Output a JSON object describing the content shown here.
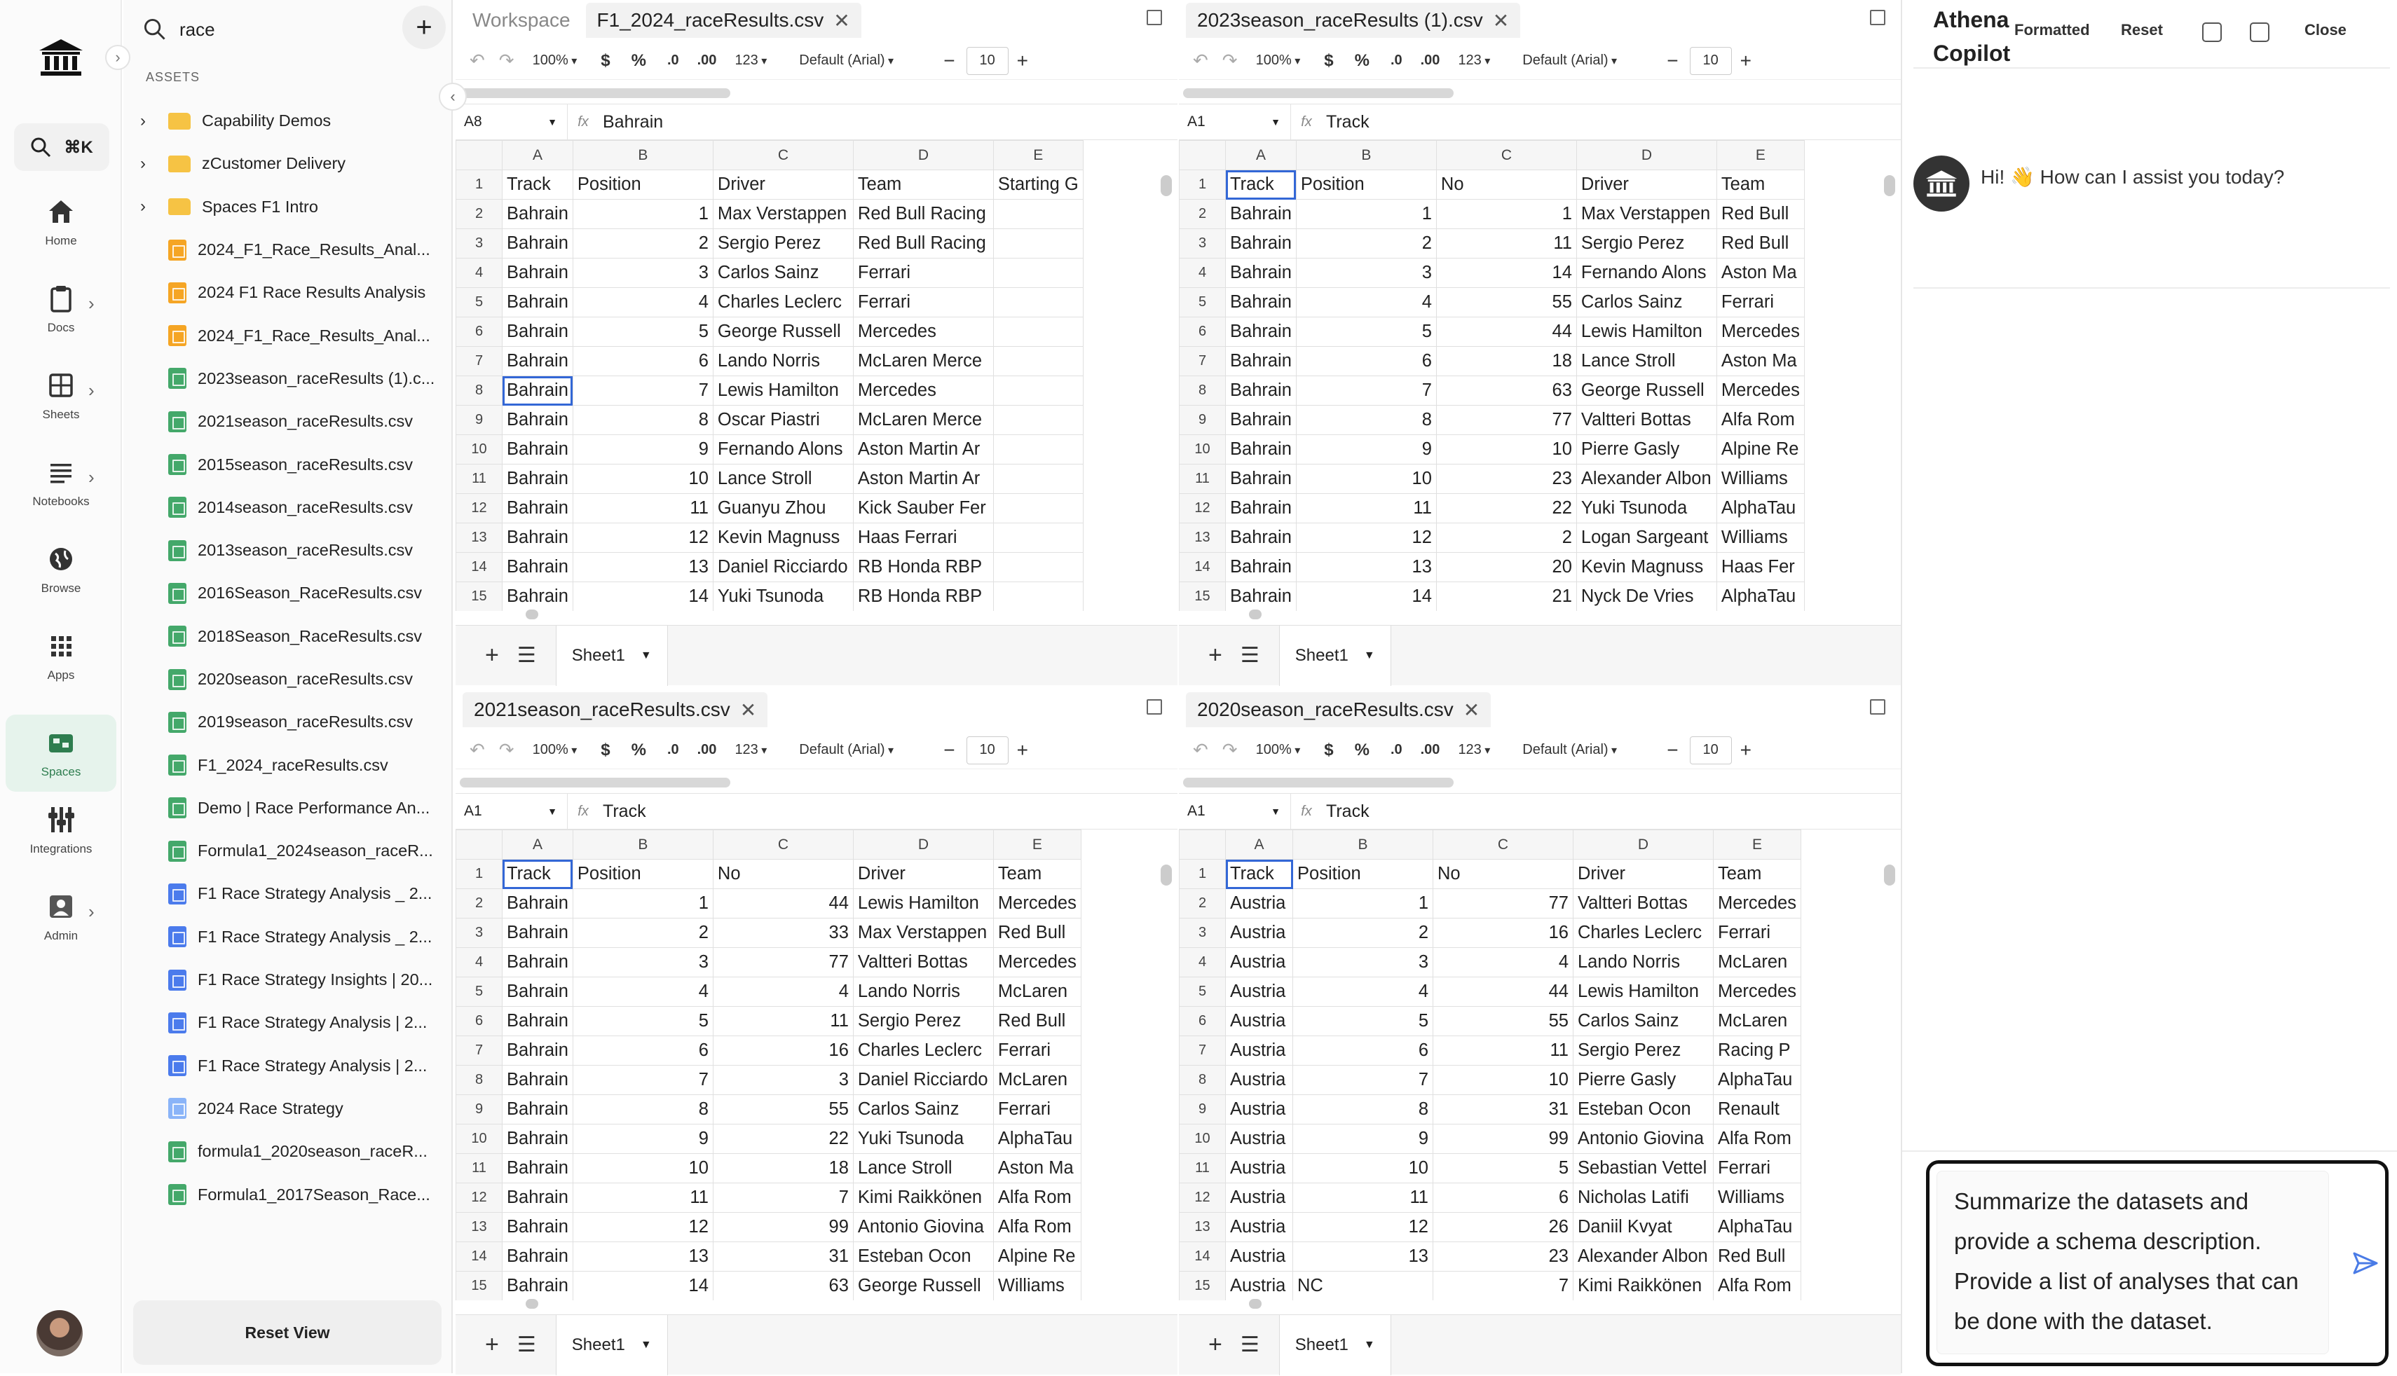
{
  "rail": {
    "search_shortcut": "⌘K",
    "items": [
      {
        "label": "Home",
        "icon": "home-icon"
      },
      {
        "label": "Docs",
        "icon": "docs-icon"
      },
      {
        "label": "Sheets",
        "icon": "sheets-icon"
      },
      {
        "label": "Notebooks",
        "icon": "notebooks-icon"
      },
      {
        "label": "Browse",
        "icon": "globe-icon"
      },
      {
        "label": "Apps",
        "icon": "apps-grid-icon"
      },
      {
        "label": "Spaces",
        "icon": "spaces-icon"
      },
      {
        "label": "Integrations",
        "icon": "integrations-icon"
      },
      {
        "label": "Admin",
        "icon": "admin-icon"
      }
    ],
    "active_item": "Spaces",
    "accent_color": "#2e7d4f"
  },
  "assets": {
    "search_value": "race",
    "section_label": "ASSETS",
    "reset_label": "Reset View",
    "items": [
      {
        "label": "Capability Demos",
        "type": "folder"
      },
      {
        "label": "zCustomer Delivery",
        "type": "folder"
      },
      {
        "label": "Spaces F1 Intro",
        "type": "folder"
      },
      {
        "label": "2024_F1_Race_Results_Anal...",
        "type": "doc"
      },
      {
        "label": "2024 F1 Race Results Analysis",
        "type": "doc"
      },
      {
        "label": "2024_F1_Race_Results_Anal...",
        "type": "doc"
      },
      {
        "label": "2023season_raceResults (1).c...",
        "type": "sheet"
      },
      {
        "label": "2021season_raceResults.csv",
        "type": "sheet"
      },
      {
        "label": "2015season_raceResults.csv",
        "type": "sheet"
      },
      {
        "label": "2014season_raceResults.csv",
        "type": "sheet"
      },
      {
        "label": "2013season_raceResults.csv",
        "type": "sheet"
      },
      {
        "label": "2016Season_RaceResults.csv",
        "type": "sheet"
      },
      {
        "label": "2018Season_RaceResults.csv",
        "type": "sheet"
      },
      {
        "label": "2020season_raceResults.csv",
        "type": "sheet"
      },
      {
        "label": "2019season_raceResults.csv",
        "type": "sheet"
      },
      {
        "label": "F1_2024_raceResults.csv",
        "type": "sheet"
      },
      {
        "label": "Demo | Race Performance An...",
        "type": "sheet"
      },
      {
        "label": "Formula1_2024season_raceR...",
        "type": "sheet"
      },
      {
        "label": "F1 Race Strategy Analysis _ 2...",
        "type": "nb"
      },
      {
        "label": "F1 Race Strategy Analysis _ 2...",
        "type": "nb"
      },
      {
        "label": "F1 Race Strategy Insights | 20...",
        "type": "nb"
      },
      {
        "label": "F1 Race Strategy Analysis | 2...",
        "type": "nb"
      },
      {
        "label": "F1 Race Strategy Analysis | 2...",
        "type": "nb"
      },
      {
        "label": "2024 Race Strategy",
        "type": "lightdoc"
      },
      {
        "label": "formula1_2020season_raceR...",
        "type": "sheet"
      },
      {
        "label": "Formula1_2017Season_Race...",
        "type": "sheet"
      }
    ]
  },
  "toolbar": {
    "zoom": "100%",
    "currency": "$",
    "percent": "%",
    "dec_less": ".0",
    "dec_more": ".00",
    "number_format": "123",
    "font": "Default (Arial)",
    "minus": "−",
    "font_size": "10",
    "plus": "+"
  },
  "panes": [
    {
      "workspace_label": "Workspace",
      "tab": "F1_2024_raceResults.csv",
      "cell_ref": "A8",
      "formula": "Bahrain",
      "sheet": "Sheet1",
      "columns": [
        "A",
        "B",
        "C",
        "D",
        "E"
      ],
      "rows": [
        [
          "Track",
          "Position",
          "Driver",
          "Team",
          "Starting G"
        ],
        [
          "Bahrain",
          "1",
          "Max Verstappen",
          "Red Bull Racing",
          ""
        ],
        [
          "Bahrain",
          "2",
          "Sergio Perez",
          "Red Bull Racing",
          ""
        ],
        [
          "Bahrain",
          "3",
          "Carlos Sainz",
          "Ferrari",
          ""
        ],
        [
          "Bahrain",
          "4",
          "Charles Leclerc",
          "Ferrari",
          ""
        ],
        [
          "Bahrain",
          "5",
          "George Russell",
          "Mercedes",
          ""
        ],
        [
          "Bahrain",
          "6",
          "Lando Norris",
          "McLaren Merce",
          ""
        ],
        [
          "Bahrain",
          "7",
          "Lewis Hamilton",
          "Mercedes",
          ""
        ],
        [
          "Bahrain",
          "8",
          "Oscar Piastri",
          "McLaren Merce",
          ""
        ],
        [
          "Bahrain",
          "9",
          "Fernando Alons",
          "Aston Martin Ar",
          ""
        ],
        [
          "Bahrain",
          "10",
          "Lance Stroll",
          "Aston Martin Ar",
          ""
        ],
        [
          "Bahrain",
          "11",
          "Guanyu Zhou",
          "Kick Sauber Fer",
          ""
        ],
        [
          "Bahrain",
          "12",
          "Kevin Magnuss",
          "Haas Ferrari",
          ""
        ],
        [
          "Bahrain",
          "13",
          "Daniel Ricciardo",
          "RB Honda RBP",
          ""
        ],
        [
          "Bahrain",
          "14",
          "Yuki Tsunoda",
          "RB Honda RBP",
          ""
        ]
      ]
    },
    {
      "tab": "2023season_raceResults (1).csv",
      "cell_ref": "A1",
      "formula": "Track",
      "sheet": "Sheet1",
      "columns": [
        "A",
        "B",
        "C",
        "D",
        "E"
      ],
      "rows": [
        [
          "Track",
          "Position",
          "No",
          "Driver",
          "Team"
        ],
        [
          "Bahrain",
          "1",
          "1",
          "Max Verstappen",
          "Red Bull"
        ],
        [
          "Bahrain",
          "2",
          "11",
          "Sergio Perez",
          "Red Bull"
        ],
        [
          "Bahrain",
          "3",
          "14",
          "Fernando Alons",
          "Aston Ma"
        ],
        [
          "Bahrain",
          "4",
          "55",
          "Carlos Sainz",
          "Ferrari"
        ],
        [
          "Bahrain",
          "5",
          "44",
          "Lewis Hamilton",
          "Mercedes"
        ],
        [
          "Bahrain",
          "6",
          "18",
          "Lance Stroll",
          "Aston Ma"
        ],
        [
          "Bahrain",
          "7",
          "63",
          "George Russell",
          "Mercedes"
        ],
        [
          "Bahrain",
          "8",
          "77",
          "Valtteri Bottas",
          "Alfa Rom"
        ],
        [
          "Bahrain",
          "9",
          "10",
          "Pierre Gasly",
          "Alpine Re"
        ],
        [
          "Bahrain",
          "10",
          "23",
          "Alexander Albon",
          "Williams"
        ],
        [
          "Bahrain",
          "11",
          "22",
          "Yuki Tsunoda",
          "AlphaTau"
        ],
        [
          "Bahrain",
          "12",
          "2",
          "Logan Sargeant",
          "Williams"
        ],
        [
          "Bahrain",
          "13",
          "20",
          "Kevin Magnuss",
          "Haas Fer"
        ],
        [
          "Bahrain",
          "14",
          "21",
          "Nyck De Vries",
          "AlphaTau"
        ]
      ]
    },
    {
      "tab": "2021season_raceResults.csv",
      "cell_ref": "A1",
      "formula": "Track",
      "sheet": "Sheet1",
      "columns": [
        "A",
        "B",
        "C",
        "D",
        "E"
      ],
      "rows": [
        [
          "Track",
          "Position",
          "No",
          "Driver",
          "Team"
        ],
        [
          "Bahrain",
          "1",
          "44",
          "Lewis Hamilton",
          "Mercedes"
        ],
        [
          "Bahrain",
          "2",
          "33",
          "Max Verstappen",
          "Red Bull"
        ],
        [
          "Bahrain",
          "3",
          "77",
          "Valtteri Bottas",
          "Mercedes"
        ],
        [
          "Bahrain",
          "4",
          "4",
          "Lando Norris",
          "McLaren"
        ],
        [
          "Bahrain",
          "5",
          "11",
          "Sergio Perez",
          "Red Bull"
        ],
        [
          "Bahrain",
          "6",
          "16",
          "Charles Leclerc",
          "Ferrari"
        ],
        [
          "Bahrain",
          "7",
          "3",
          "Daniel Ricciardo",
          "McLaren"
        ],
        [
          "Bahrain",
          "8",
          "55",
          "Carlos Sainz",
          "Ferrari"
        ],
        [
          "Bahrain",
          "9",
          "22",
          "Yuki Tsunoda",
          "AlphaTau"
        ],
        [
          "Bahrain",
          "10",
          "18",
          "Lance Stroll",
          "Aston Ma"
        ],
        [
          "Bahrain",
          "11",
          "7",
          "Kimi Raikkönen",
          "Alfa Rom"
        ],
        [
          "Bahrain",
          "12",
          "99",
          "Antonio Giovina",
          "Alfa Rom"
        ],
        [
          "Bahrain",
          "13",
          "31",
          "Esteban Ocon",
          "Alpine Re"
        ],
        [
          "Bahrain",
          "14",
          "63",
          "George Russell",
          "Williams"
        ]
      ]
    },
    {
      "tab": "2020season_raceResults.csv",
      "cell_ref": "A1",
      "formula": "Track",
      "sheet": "Sheet1",
      "columns": [
        "A",
        "B",
        "C",
        "D",
        "E"
      ],
      "rows": [
        [
          "Track",
          "Position",
          "No",
          "Driver",
          "Team"
        ],
        [
          "Austria",
          "1",
          "77",
          "Valtteri Bottas",
          "Mercedes"
        ],
        [
          "Austria",
          "2",
          "16",
          "Charles Leclerc",
          "Ferrari"
        ],
        [
          "Austria",
          "3",
          "4",
          "Lando Norris",
          "McLaren"
        ],
        [
          "Austria",
          "4",
          "44",
          "Lewis Hamilton",
          "Mercedes"
        ],
        [
          "Austria",
          "5",
          "55",
          "Carlos Sainz",
          "McLaren"
        ],
        [
          "Austria",
          "6",
          "11",
          "Sergio Perez",
          "Racing P"
        ],
        [
          "Austria",
          "7",
          "10",
          "Pierre Gasly",
          "AlphaTau"
        ],
        [
          "Austria",
          "8",
          "31",
          "Esteban Ocon",
          "Renault"
        ],
        [
          "Austria",
          "9",
          "99",
          "Antonio Giovina",
          "Alfa Rom"
        ],
        [
          "Austria",
          "10",
          "5",
          "Sebastian Vettel",
          "Ferrari"
        ],
        [
          "Austria",
          "11",
          "6",
          "Nicholas Latifi",
          "Williams"
        ],
        [
          "Austria",
          "12",
          "26",
          "Daniil Kvyat",
          "AlphaTau"
        ],
        [
          "Austria",
          "13",
          "23",
          "Alexander Albon",
          "Red Bull"
        ],
        [
          "Austria",
          "NC",
          "7",
          "Kimi Raikkönen",
          "Alfa Rom"
        ]
      ]
    }
  ],
  "copilot": {
    "title_line1": "Athena",
    "title_line2": "Copilot",
    "formatted_label": "Formatted",
    "reset_label": "Reset",
    "close_label": "Close",
    "greeting": "Hi! 👋 How can I assist you today?",
    "input_value": "Summarize the datasets and provide a schema description. Provide a list of analyses that can be done with the dataset."
  }
}
